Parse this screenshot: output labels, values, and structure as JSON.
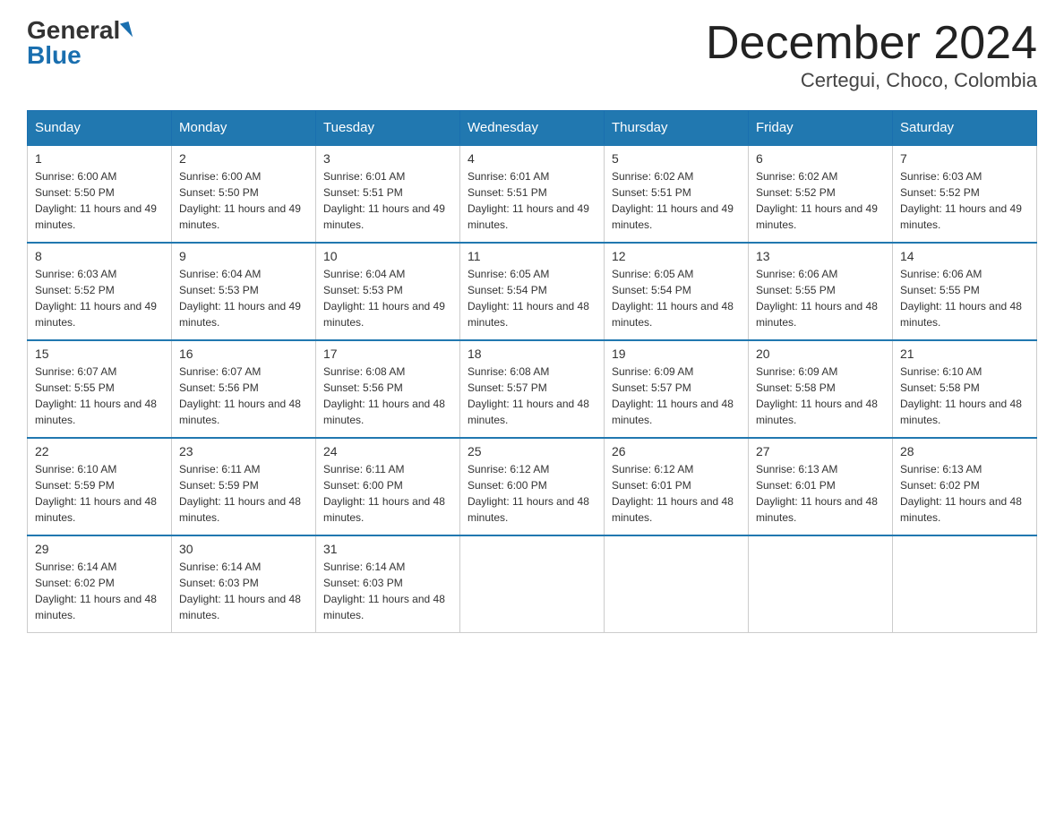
{
  "header": {
    "logo_general": "General",
    "logo_blue": "Blue",
    "month_title": "December 2024",
    "location": "Certegui, Choco, Colombia"
  },
  "days_of_week": [
    "Sunday",
    "Monday",
    "Tuesday",
    "Wednesday",
    "Thursday",
    "Friday",
    "Saturday"
  ],
  "weeks": [
    [
      {
        "day": "1",
        "sunrise": "6:00 AM",
        "sunset": "5:50 PM",
        "daylight": "11 hours and 49 minutes."
      },
      {
        "day": "2",
        "sunrise": "6:00 AM",
        "sunset": "5:50 PM",
        "daylight": "11 hours and 49 minutes."
      },
      {
        "day": "3",
        "sunrise": "6:01 AM",
        "sunset": "5:51 PM",
        "daylight": "11 hours and 49 minutes."
      },
      {
        "day": "4",
        "sunrise": "6:01 AM",
        "sunset": "5:51 PM",
        "daylight": "11 hours and 49 minutes."
      },
      {
        "day": "5",
        "sunrise": "6:02 AM",
        "sunset": "5:51 PM",
        "daylight": "11 hours and 49 minutes."
      },
      {
        "day": "6",
        "sunrise": "6:02 AM",
        "sunset": "5:52 PM",
        "daylight": "11 hours and 49 minutes."
      },
      {
        "day": "7",
        "sunrise": "6:03 AM",
        "sunset": "5:52 PM",
        "daylight": "11 hours and 49 minutes."
      }
    ],
    [
      {
        "day": "8",
        "sunrise": "6:03 AM",
        "sunset": "5:52 PM",
        "daylight": "11 hours and 49 minutes."
      },
      {
        "day": "9",
        "sunrise": "6:04 AM",
        "sunset": "5:53 PM",
        "daylight": "11 hours and 49 minutes."
      },
      {
        "day": "10",
        "sunrise": "6:04 AM",
        "sunset": "5:53 PM",
        "daylight": "11 hours and 49 minutes."
      },
      {
        "day": "11",
        "sunrise": "6:05 AM",
        "sunset": "5:54 PM",
        "daylight": "11 hours and 48 minutes."
      },
      {
        "day": "12",
        "sunrise": "6:05 AM",
        "sunset": "5:54 PM",
        "daylight": "11 hours and 48 minutes."
      },
      {
        "day": "13",
        "sunrise": "6:06 AM",
        "sunset": "5:55 PM",
        "daylight": "11 hours and 48 minutes."
      },
      {
        "day": "14",
        "sunrise": "6:06 AM",
        "sunset": "5:55 PM",
        "daylight": "11 hours and 48 minutes."
      }
    ],
    [
      {
        "day": "15",
        "sunrise": "6:07 AM",
        "sunset": "5:55 PM",
        "daylight": "11 hours and 48 minutes."
      },
      {
        "day": "16",
        "sunrise": "6:07 AM",
        "sunset": "5:56 PM",
        "daylight": "11 hours and 48 minutes."
      },
      {
        "day": "17",
        "sunrise": "6:08 AM",
        "sunset": "5:56 PM",
        "daylight": "11 hours and 48 minutes."
      },
      {
        "day": "18",
        "sunrise": "6:08 AM",
        "sunset": "5:57 PM",
        "daylight": "11 hours and 48 minutes."
      },
      {
        "day": "19",
        "sunrise": "6:09 AM",
        "sunset": "5:57 PM",
        "daylight": "11 hours and 48 minutes."
      },
      {
        "day": "20",
        "sunrise": "6:09 AM",
        "sunset": "5:58 PM",
        "daylight": "11 hours and 48 minutes."
      },
      {
        "day": "21",
        "sunrise": "6:10 AM",
        "sunset": "5:58 PM",
        "daylight": "11 hours and 48 minutes."
      }
    ],
    [
      {
        "day": "22",
        "sunrise": "6:10 AM",
        "sunset": "5:59 PM",
        "daylight": "11 hours and 48 minutes."
      },
      {
        "day": "23",
        "sunrise": "6:11 AM",
        "sunset": "5:59 PM",
        "daylight": "11 hours and 48 minutes."
      },
      {
        "day": "24",
        "sunrise": "6:11 AM",
        "sunset": "6:00 PM",
        "daylight": "11 hours and 48 minutes."
      },
      {
        "day": "25",
        "sunrise": "6:12 AM",
        "sunset": "6:00 PM",
        "daylight": "11 hours and 48 minutes."
      },
      {
        "day": "26",
        "sunrise": "6:12 AM",
        "sunset": "6:01 PM",
        "daylight": "11 hours and 48 minutes."
      },
      {
        "day": "27",
        "sunrise": "6:13 AM",
        "sunset": "6:01 PM",
        "daylight": "11 hours and 48 minutes."
      },
      {
        "day": "28",
        "sunrise": "6:13 AM",
        "sunset": "6:02 PM",
        "daylight": "11 hours and 48 minutes."
      }
    ],
    [
      {
        "day": "29",
        "sunrise": "6:14 AM",
        "sunset": "6:02 PM",
        "daylight": "11 hours and 48 minutes."
      },
      {
        "day": "30",
        "sunrise": "6:14 AM",
        "sunset": "6:03 PM",
        "daylight": "11 hours and 48 minutes."
      },
      {
        "day": "31",
        "sunrise": "6:14 AM",
        "sunset": "6:03 PM",
        "daylight": "11 hours and 48 minutes."
      },
      null,
      null,
      null,
      null
    ]
  ]
}
